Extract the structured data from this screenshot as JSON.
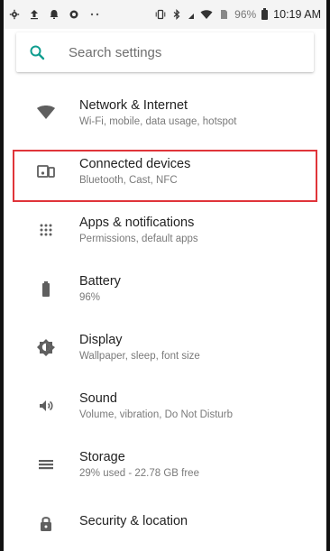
{
  "status_bar": {
    "battery": "96%",
    "time": "10:19 AM",
    "left_icons": [
      "settings-gear-icon",
      "upload-icon",
      "notification-icon",
      "shield-icon",
      "dots-icon"
    ],
    "right_icons": [
      "vibrate-icon",
      "bluetooth-icon",
      "signal-icon",
      "wifi-icon",
      "battery-icon"
    ]
  },
  "search": {
    "placeholder": "Search settings"
  },
  "settings": [
    {
      "key": "network",
      "icon": "wifi-icon",
      "title": "Network & Internet",
      "subtitle": "Wi-Fi, mobile, data usage, hotspot"
    },
    {
      "key": "connected",
      "icon": "connected-devices-icon",
      "title": "Connected devices",
      "subtitle": "Bluetooth, Cast, NFC"
    },
    {
      "key": "apps",
      "icon": "apps-grid-icon",
      "title": "Apps & notifications",
      "subtitle": "Permissions, default apps"
    },
    {
      "key": "battery",
      "icon": "battery-icon",
      "title": "Battery",
      "subtitle": "96%"
    },
    {
      "key": "display",
      "icon": "brightness-icon",
      "title": "Display",
      "subtitle": "Wallpaper, sleep, font size"
    },
    {
      "key": "sound",
      "icon": "speaker-icon",
      "title": "Sound",
      "subtitle": "Volume, vibration, Do Not Disturb"
    },
    {
      "key": "storage",
      "icon": "storage-icon",
      "title": "Storage",
      "subtitle": "29% used - 22.78 GB free"
    },
    {
      "key": "security",
      "icon": "lock-icon",
      "title": "Security & location",
      "subtitle": ""
    }
  ],
  "colors": {
    "accent": "#0f9d8f",
    "highlight": "#e0353a"
  }
}
